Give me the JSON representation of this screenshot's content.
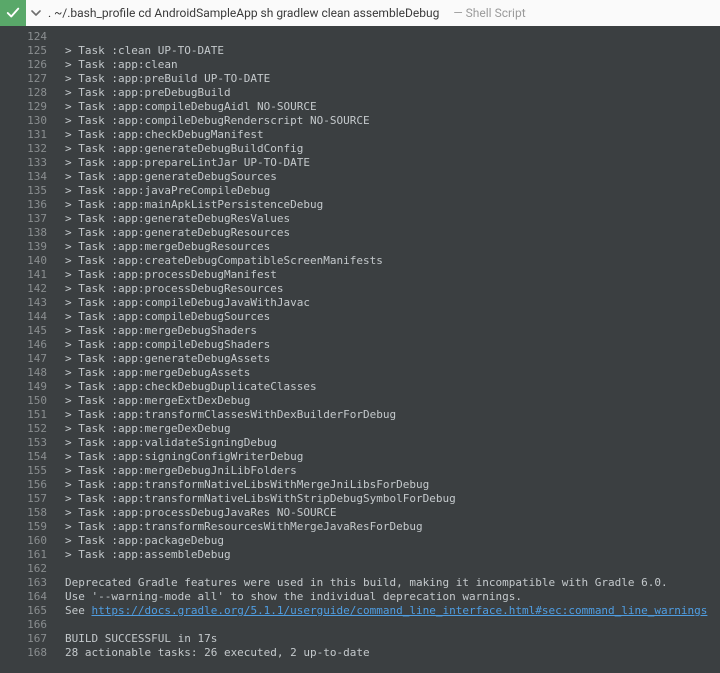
{
  "header": {
    "title": ". ~/.bash_profile cd AndroidSampleApp sh gradlew clean assembleDebug",
    "subtitle": "— Shell Script"
  },
  "gutter_start": 124,
  "lines": [
    "",
    "> Task :clean UP-TO-DATE",
    "> Task :app:clean",
    "> Task :app:preBuild UP-TO-DATE",
    "> Task :app:preDebugBuild",
    "> Task :app:compileDebugAidl NO-SOURCE",
    "> Task :app:compileDebugRenderscript NO-SOURCE",
    "> Task :app:checkDebugManifest",
    "> Task :app:generateDebugBuildConfig",
    "> Task :app:prepareLintJar UP-TO-DATE",
    "> Task :app:generateDebugSources",
    "> Task :app:javaPreCompileDebug",
    "> Task :app:mainApkListPersistenceDebug",
    "> Task :app:generateDebugResValues",
    "> Task :app:generateDebugResources",
    "> Task :app:mergeDebugResources",
    "> Task :app:createDebugCompatibleScreenManifests",
    "> Task :app:processDebugManifest",
    "> Task :app:processDebugResources",
    "> Task :app:compileDebugJavaWithJavac",
    "> Task :app:compileDebugSources",
    "> Task :app:mergeDebugShaders",
    "> Task :app:compileDebugShaders",
    "> Task :app:generateDebugAssets",
    "> Task :app:mergeDebugAssets",
    "> Task :app:checkDebugDuplicateClasses",
    "> Task :app:mergeExtDexDebug",
    "> Task :app:transformClassesWithDexBuilderForDebug",
    "> Task :app:mergeDexDebug",
    "> Task :app:validateSigningDebug",
    "> Task :app:signingConfigWriterDebug",
    "> Task :app:mergeDebugJniLibFolders",
    "> Task :app:transformNativeLibsWithMergeJniLibsForDebug",
    "> Task :app:transformNativeLibsWithStripDebugSymbolForDebug",
    "> Task :app:processDebugJavaRes NO-SOURCE",
    "> Task :app:transformResourcesWithMergeJavaResForDebug",
    "> Task :app:packageDebug",
    "> Task :app:assembleDebug",
    "",
    "Deprecated Gradle features were used in this build, making it incompatible with Gradle 6.0.",
    "Use '--warning-mode all' to show the individual deprecation warnings.",
    "See ",
    "",
    "BUILD SUCCESSFUL in 17s",
    "28 actionable tasks: 26 executed, 2 up-to-date"
  ],
  "link_line_index": 41,
  "link_text": "https://docs.gradle.org/5.1.1/userguide/command_line_interface.html#sec:command_line_warnings"
}
